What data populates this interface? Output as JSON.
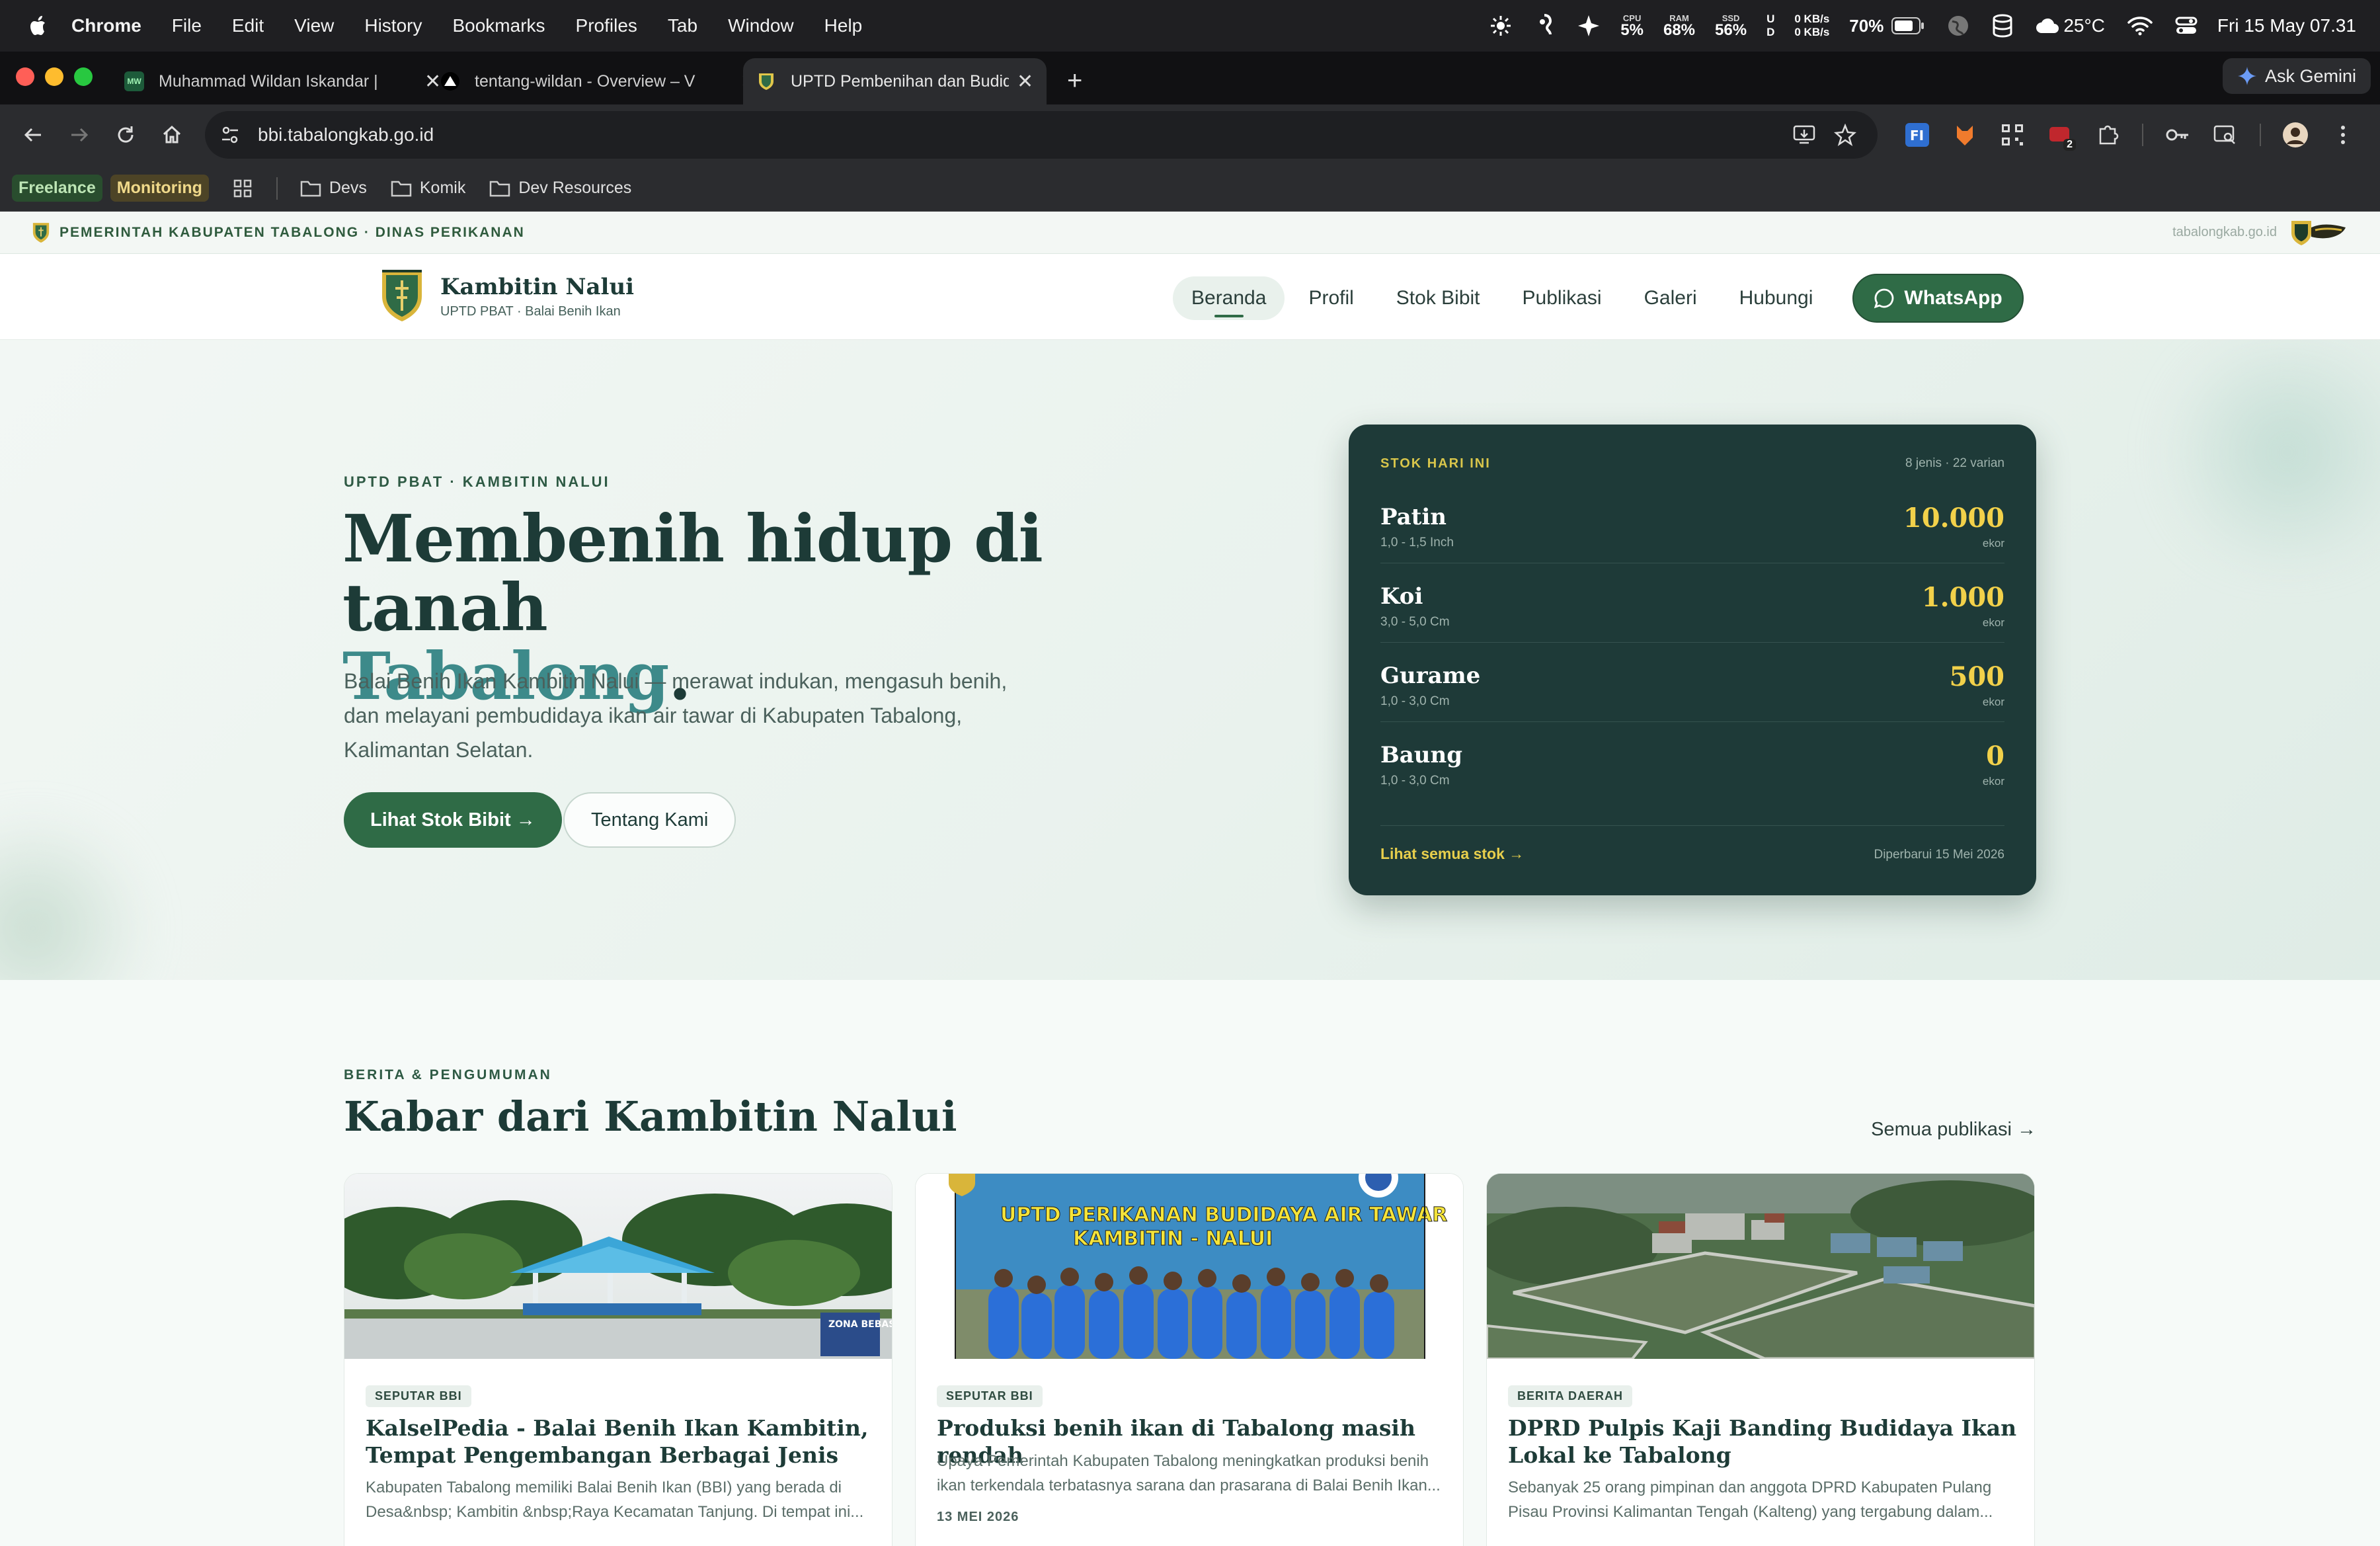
{
  "menubar": {
    "app": "Chrome",
    "items": [
      "File",
      "Edit",
      "View",
      "History",
      "Bookmarks",
      "Profiles",
      "Tab",
      "Window",
      "Help"
    ],
    "cpu_label": "CPU",
    "cpu_value": "5%",
    "ram_label": "RAM",
    "ram_value": "68%",
    "ssd_label": "SSD",
    "ssd_value": "56%",
    "ud_top": "U",
    "ud_bottom": "D",
    "net_up": "0 KB/s",
    "net_down": "0 KB/s",
    "battery": "70%",
    "weather": "25°C",
    "datetime": "Fri 15 May  07.31"
  },
  "tabs": [
    {
      "label": "Muhammad Wildan Iskandar |",
      "favicon": "mw-icon"
    },
    {
      "label": "tentang-wildan - Overview – V",
      "favicon": "vercel-triangle-icon"
    },
    {
      "label": "UPTD Pembenihan dan Budid",
      "favicon": "shield-crest-icon",
      "active": true
    }
  ],
  "ask_gemini": "Ask Gemini",
  "address": {
    "url": "bbi.tabalongkab.go.id"
  },
  "bookmarks": [
    {
      "label": "Freelance",
      "color": "#294d2e",
      "text": "#bde5b5"
    },
    {
      "label": "Monitoring",
      "color": "#4d4426",
      "text": "#f0d98a"
    },
    {
      "label": "Devs"
    },
    {
      "label": "Komik"
    },
    {
      "label": "Dev Resources"
    }
  ],
  "extension_badge": "2",
  "site": {
    "govbar_text": "PEMERINTAH KABUPATEN TABALONG · DINAS PERIKANAN",
    "govbar_domain": "tabalongkab.go.id",
    "brand_name": "Kambitin Nalui",
    "brand_sub": "UPTD PBAT · Balai Benih Ikan",
    "nav": [
      "Beranda",
      "Profil",
      "Stok Bibit",
      "Publikasi",
      "Galeri",
      "Hubungi"
    ],
    "whatsapp": "WhatsApp",
    "hero": {
      "eyebrow": "UPTD PBAT · KAMBITIN NALUI",
      "title_line1": "Membenih hidup di tanah",
      "title_accent": "Tabalong",
      "title_end": ".",
      "lead": "Balai Benih Ikan Kambitin Nalui — merawat indukan, mengasuh benih, dan melayani pembudidaya ikan air tawar di Kabupaten Tabalong, Kalimantan Selatan.",
      "btn_primary": "Lihat Stok Bibit →",
      "btn_secondary": "Tentang Kami"
    },
    "stock": {
      "header": "STOK HARI INI",
      "meta": "8 jenis · 22 varian",
      "rows": [
        {
          "name": "Patin",
          "size": "1,0 - 1,5 Inch",
          "qty": "10.000",
          "unit": "ekor"
        },
        {
          "name": "Koi",
          "size": "3,0 - 5,0 Cm",
          "qty": "1.000",
          "unit": "ekor"
        },
        {
          "name": "Gurame",
          "size": "1,0 - 3,0 Cm",
          "qty": "500",
          "unit": "ekor"
        },
        {
          "name": "Baung",
          "size": "1,0 - 3,0 Cm",
          "qty": "0",
          "unit": "ekor"
        }
      ],
      "footer_link": "Lihat semua stok →",
      "updated": "Diperbarui 15 Mei 2026"
    },
    "news": {
      "eyebrow": "BERITA & PENGUMUMAN",
      "title": "Kabar dari Kambitin Nalui",
      "all_link": "Semua publikasi →",
      "cards": [
        {
          "tag": "SEPUTAR BBI",
          "title": "KalselPedia - Balai Benih Ikan Kambitin, Tempat Pengembangan Berbagai Jenis Ikan A...",
          "excerpt": "Kabupaten Tabalong memiliki Balai Benih Ikan (BBI) yang berada di Desa&nbsp; Kambitin &nbsp;Raya Kecamatan Tanjung. Di tempat ini...",
          "date": "",
          "img_sign": "ZONA BEBAS SAMPAH"
        },
        {
          "tag": "SEPUTAR BBI",
          "title": "Produksi benih ikan di Tabalong masih rendah",
          "excerpt": "Upaya Pemerintah Kabupaten Tabalong meningkatkan produksi benih ikan terkendala terbatasnya sarana dan prasarana di Balai Benih Ikan...",
          "date": "13 MEI 2026",
          "img_banner1": "UPTD PERIKANAN BUDIDAYA AIR TAWAR",
          "img_banner2": "KAMBITIN - NALUI"
        },
        {
          "tag": "BERITA DAERAH",
          "title": "DPRD Pulpis Kaji Banding Budidaya Ikan Lokal ke Tabalong",
          "excerpt": "Sebanyak 25 orang pimpinan dan anggota DPRD Kabupaten Pulang Pisau Provinsi Kalimantan Tengah (Kalteng) yang tergabung dalam...",
          "date": ""
        }
      ]
    }
  },
  "colors": {
    "primary": "#2f6b46",
    "accent": "#3d8a8a",
    "dark": "#1e3a38",
    "gold": "#f2d14a"
  }
}
